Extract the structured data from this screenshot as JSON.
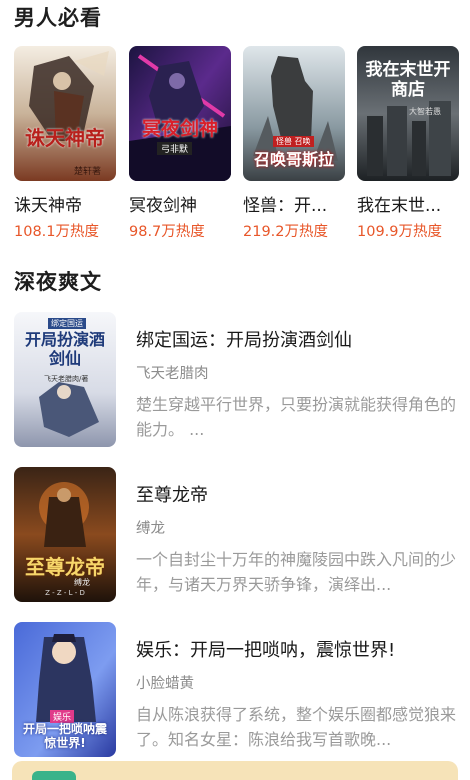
{
  "sections": {
    "men": {
      "title": "男人必看"
    },
    "night": {
      "title": "深夜爽文"
    }
  },
  "grid_books": [
    {
      "title": "诛天神帝",
      "heat": "108.1万热度",
      "cover_text": "诛天神帝",
      "cover_author": "楚轩著"
    },
    {
      "title": "冥夜剑神",
      "heat": "98.7万热度",
      "cover_text": "冥夜剑神",
      "cover_author": "弓非默"
    },
    {
      "title": "怪兽：开...",
      "heat": "219.2万热度",
      "cover_text": "召唤哥斯拉",
      "cover_tag": "怪兽 召唤"
    },
    {
      "title": "我在末世...",
      "heat": "109.9万热度",
      "cover_text": "我在末世开商店",
      "cover_author": "大智若愚"
    }
  ],
  "list_books": [
    {
      "title": "绑定国运：开局扮演酒剑仙",
      "author": "飞天老腊肉",
      "desc": "楚生穿越平行世界，只要扮演就能获得角色的能力。 ...",
      "cover_text": "开局扮演酒剑仙",
      "cover_top": "绑定国运",
      "cover_author": "飞天老腊肉/著"
    },
    {
      "title": "至尊龙帝",
      "author": "缚龙",
      "desc": "一个自封尘十万年的神魔陵园中跌入凡间的少年，与诸天万界天骄争锋，演绎出...",
      "cover_text": "至尊龙帝",
      "cover_author": "缚龙",
      "cover_bottom": "Z - Z - L - D"
    },
    {
      "title": "娱乐：开局一把唢呐，震惊世界!",
      "author": "小脸蜡黄",
      "desc": "自从陈浪获得了系统，整个娱乐圈都感觉狼来了。知名女星：陈浪给我写首歌晚...",
      "cover_text": "开局一把唢呐震惊世界!",
      "cover_top": "娱乐"
    }
  ],
  "colors": {
    "heat": "#e8572a",
    "banner": "#f6e3b8",
    "badge": "#39b38a"
  }
}
